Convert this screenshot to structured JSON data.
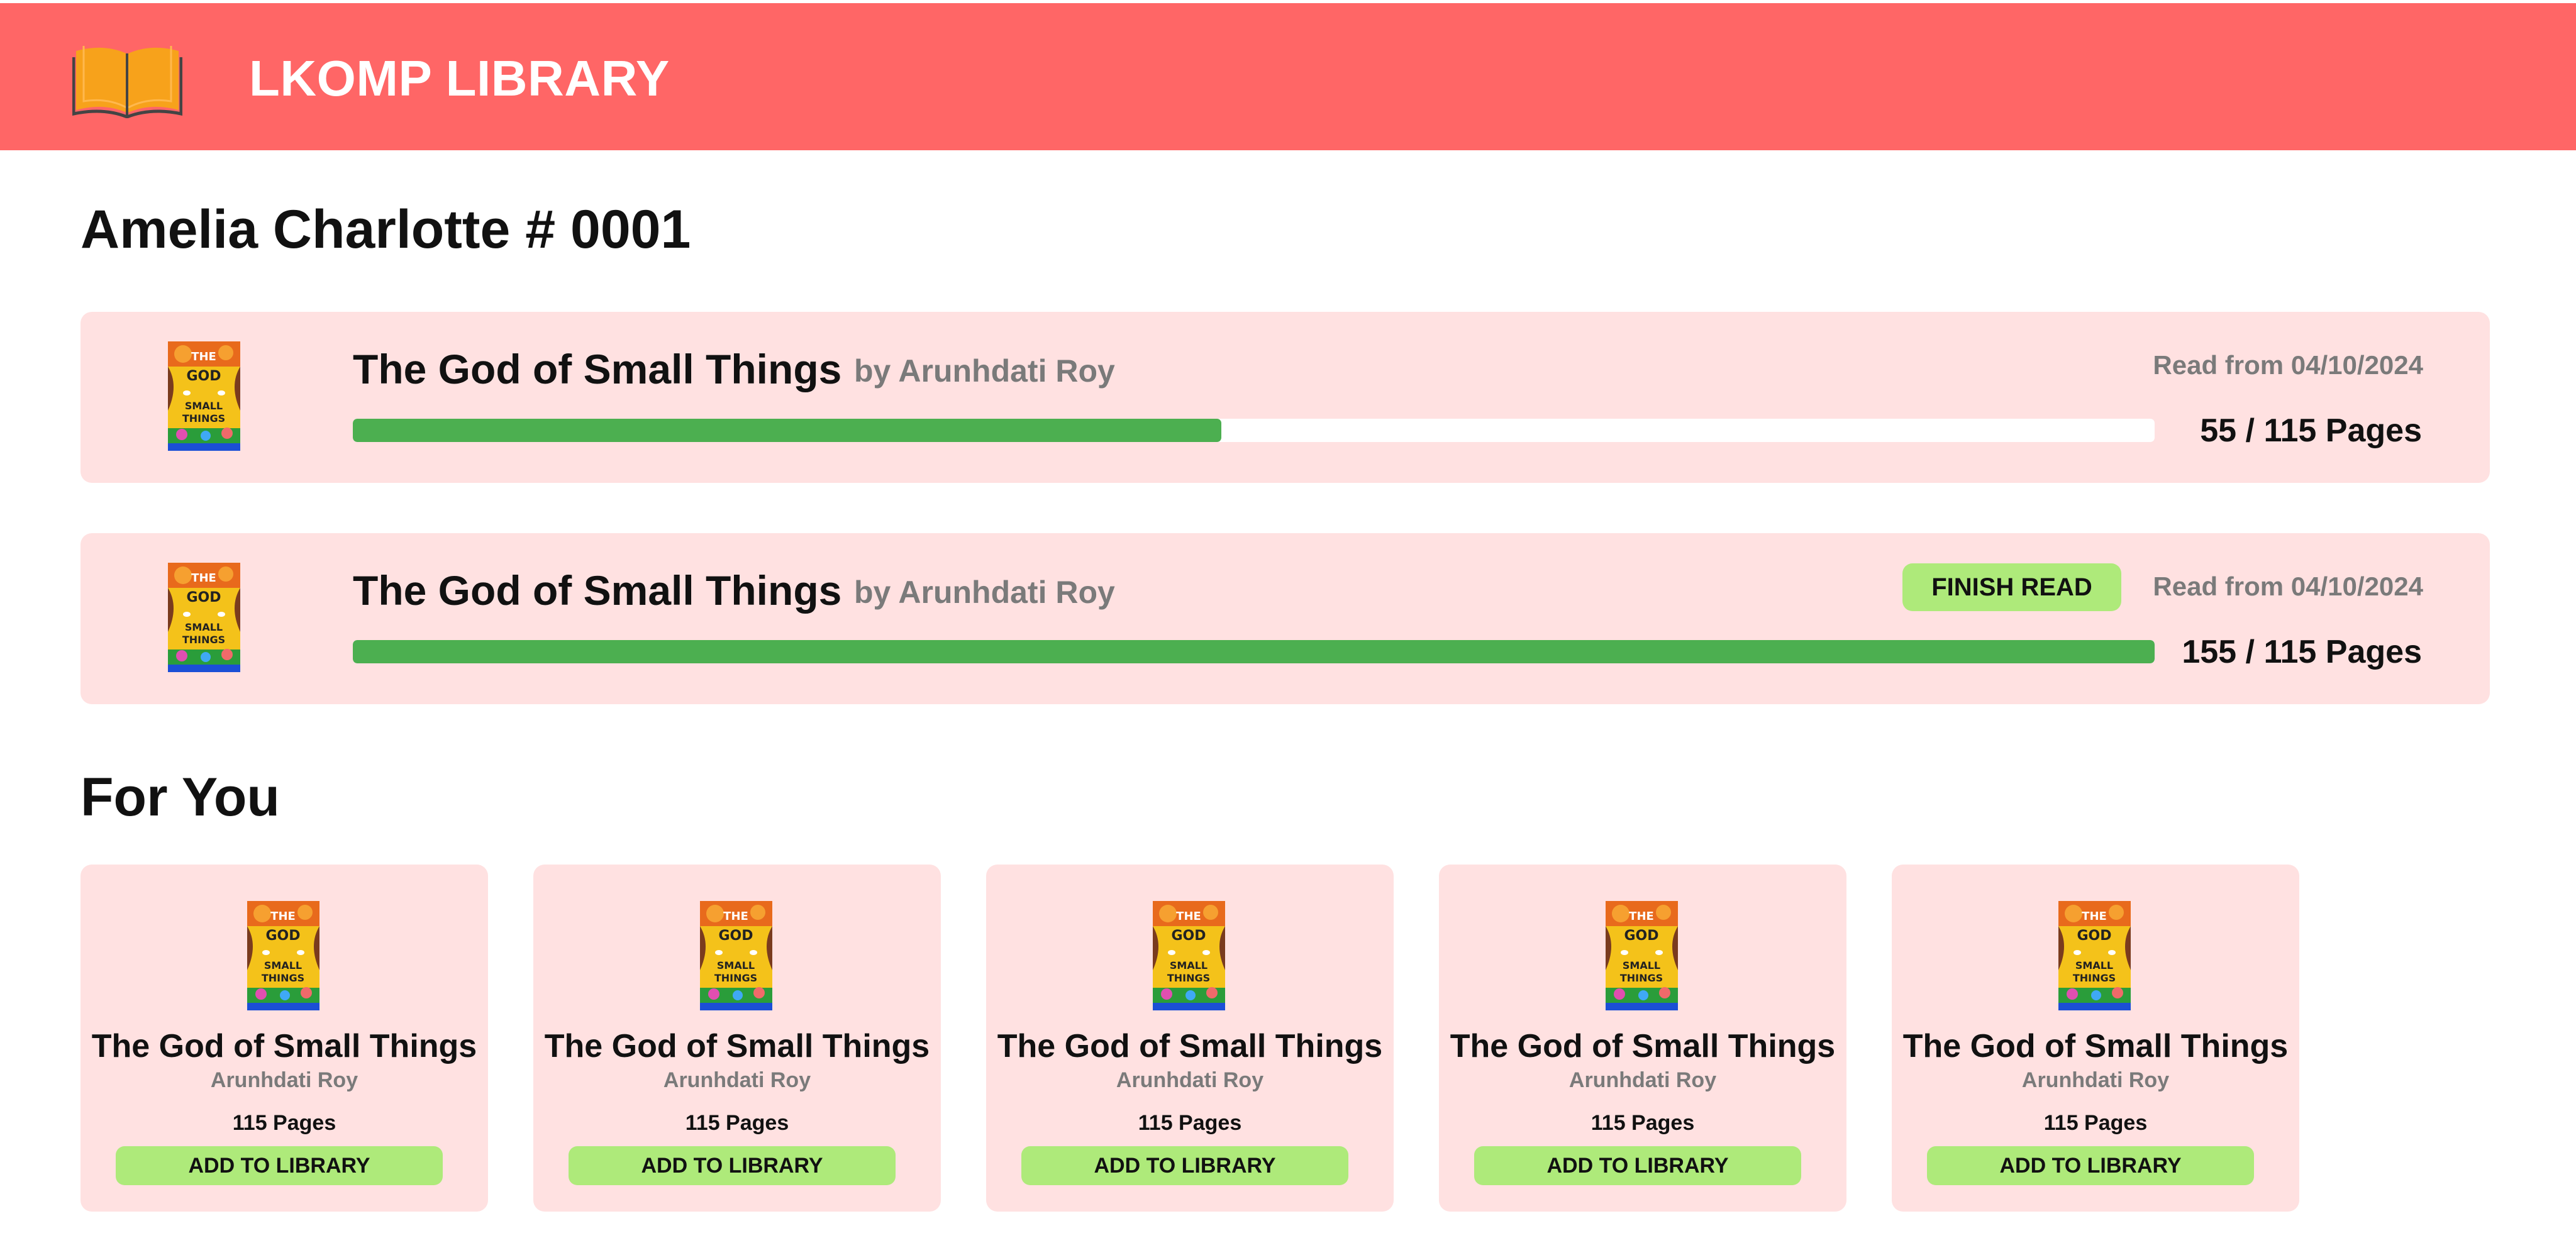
{
  "header": {
    "brand": "LKOMP LIBRARY"
  },
  "user": {
    "title": "Amelia Charlotte # 0001"
  },
  "reading": [
    {
      "title": "The God of Small Things",
      "author": "by Arunhdati Roy",
      "date": "Read from 04/10/2024",
      "pages_read": 55,
      "pages_total": 115,
      "pages_label": "55 / 115 Pages",
      "progress": 0.482,
      "finish_label": ""
    },
    {
      "title": "The God of Small Things",
      "author": "by Arunhdati Roy",
      "date": "Read from 04/10/2024",
      "pages_read": 155,
      "pages_total": 115,
      "pages_label": "155 / 115 Pages",
      "progress": 1.0,
      "finish_label": "FINISH READ"
    }
  ],
  "for_you": {
    "title": "For You",
    "books": [
      {
        "title": "The God of Small Things",
        "author": "Arunhdati Roy",
        "pages": "115 Pages",
        "button": "ADD TO LIBRARY"
      },
      {
        "title": "The God of Small Things",
        "author": "Arunhdati Roy",
        "pages": "115 Pages",
        "button": "ADD TO LIBRARY"
      },
      {
        "title": "The God of Small Things",
        "author": "Arunhdati Roy",
        "pages": "115 Pages",
        "button": "ADD TO LIBRARY"
      },
      {
        "title": "The God of Small Things",
        "author": "Arunhdati Roy",
        "pages": "115 Pages",
        "button": "ADD TO LIBRARY"
      },
      {
        "title": "The God of Small Things",
        "author": "Arunhdati Roy",
        "pages": "115 Pages",
        "button": "ADD TO LIBRARY"
      }
    ]
  },
  "cover_text": {
    "line1": "THE",
    "line2": "GOD",
    "line3": "SMALL",
    "line4": "THINGS"
  },
  "colors": {
    "header": "#ff6666",
    "card": "#ffe1e1",
    "progress": "#4caf50",
    "button": "#aeea7a",
    "muted": "#7a7a7a",
    "logo": "#f7a21b"
  }
}
